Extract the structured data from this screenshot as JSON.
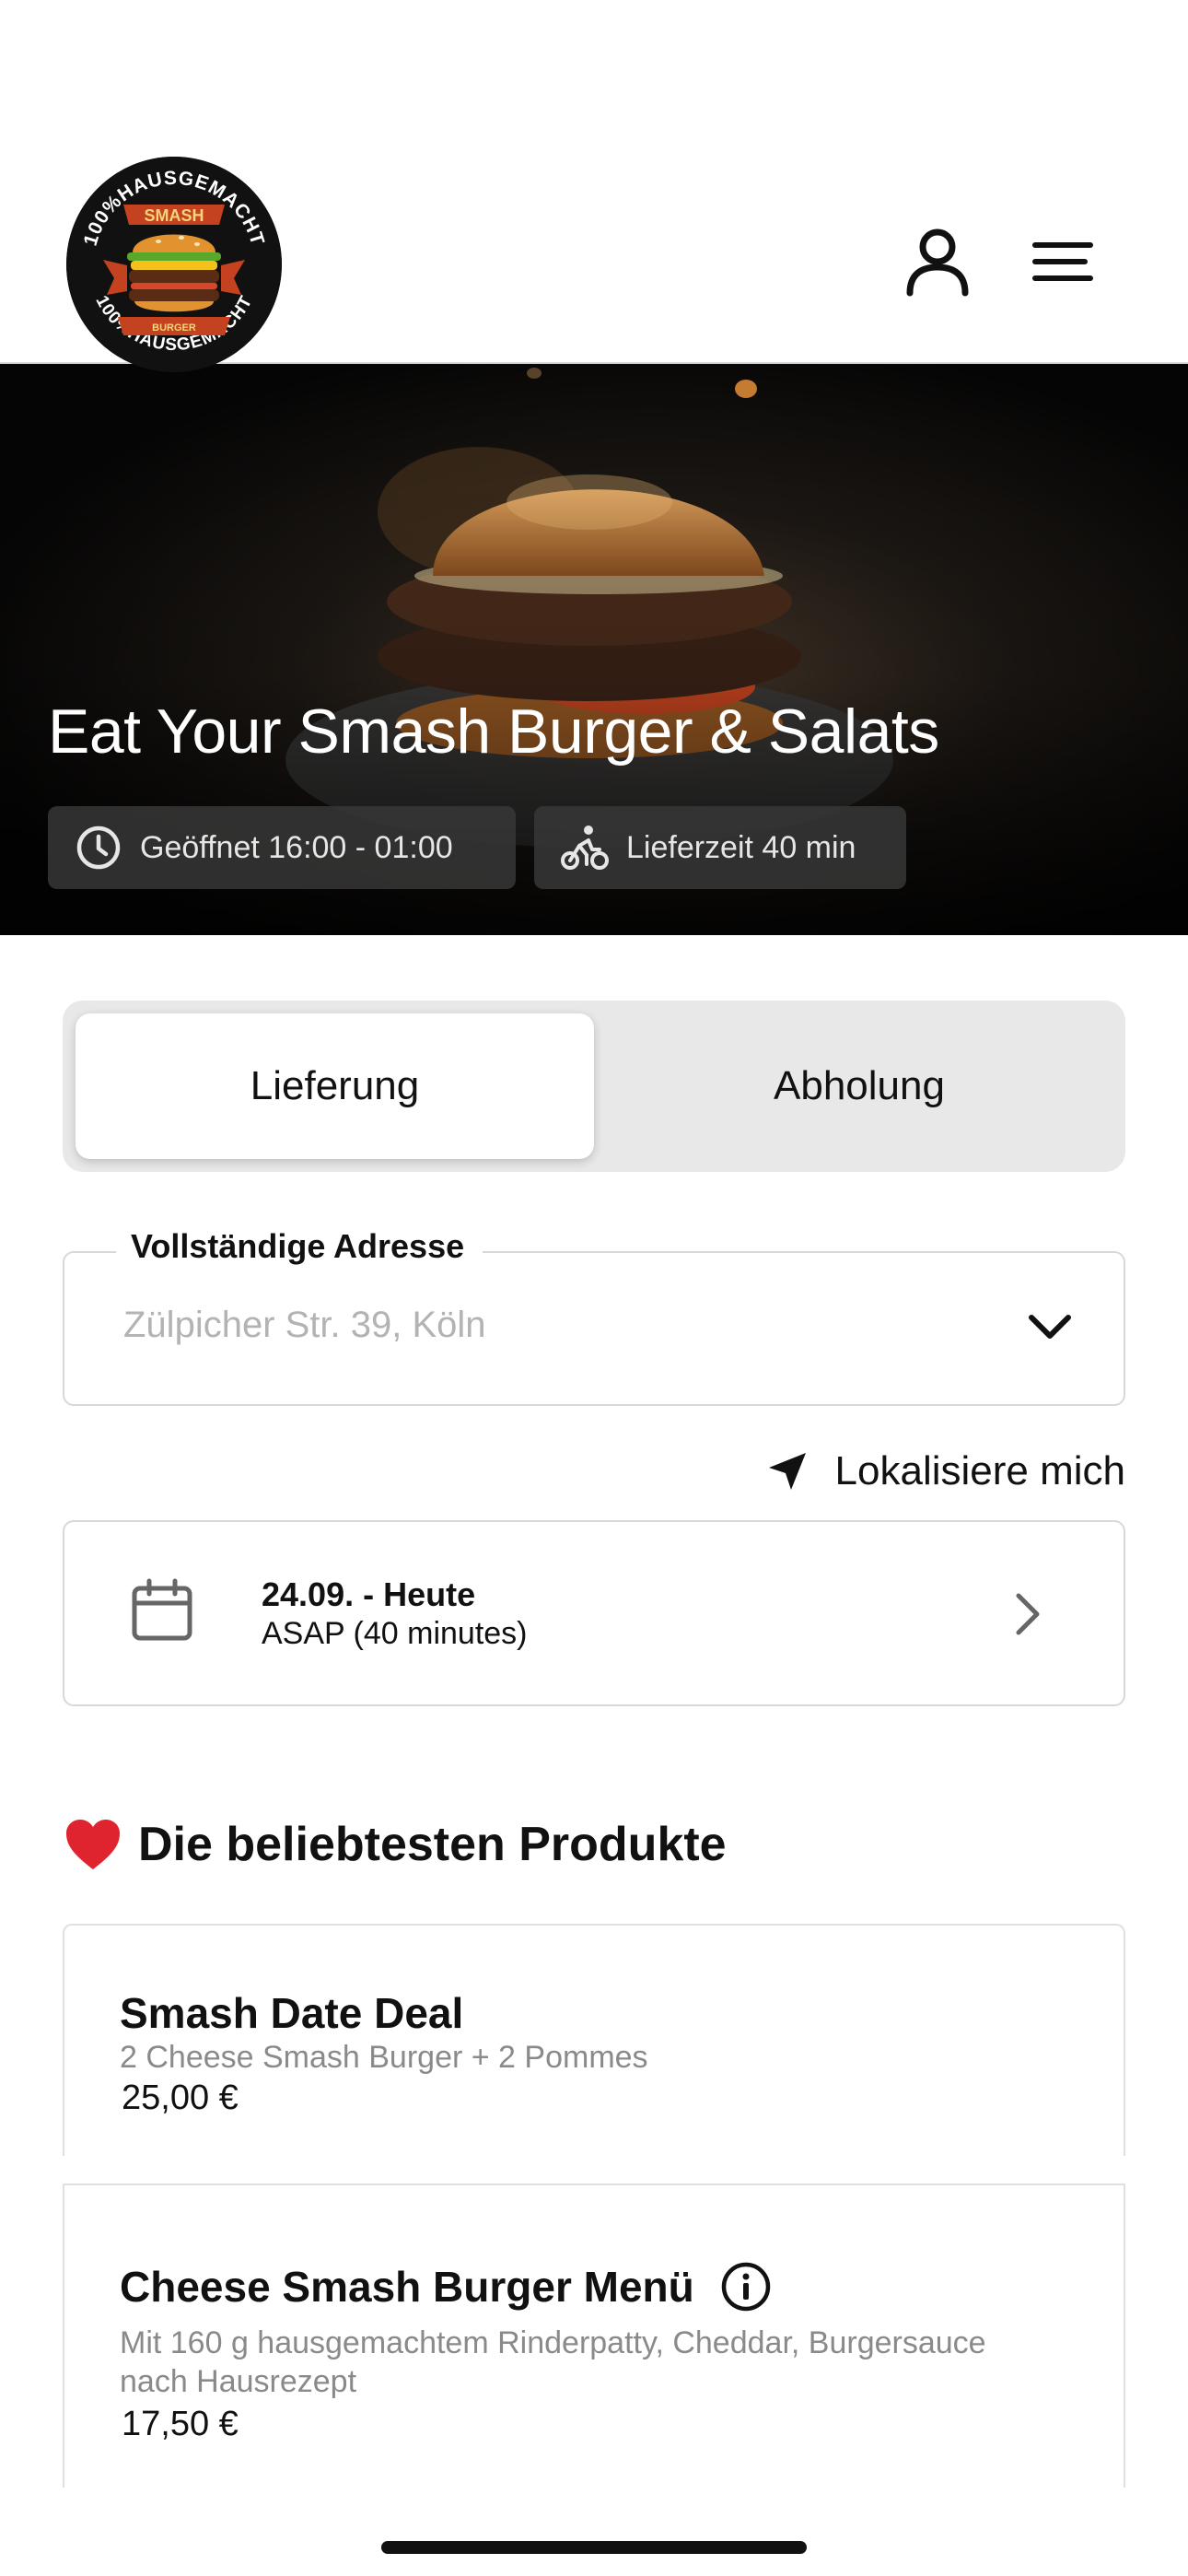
{
  "header": {
    "logo_text_top": "100%HAUSGEMACHT",
    "logo_text_bottom": "100%HAUSGEMACHT",
    "logo_brand": "SMASH",
    "logo_sub": "BURGER",
    "account_icon": "user-icon",
    "menu_icon": "hamburger-menu-icon"
  },
  "hero": {
    "title": "Eat Your Smash Burger & Salats",
    "open_hours": "Geöffnet 16:00 - 01:00",
    "delivery_time": "Lieferzeit 40 min",
    "open_icon": "clock-icon",
    "delivery_icon": "bicycle-icon"
  },
  "order_mode": {
    "options": [
      "Lieferung",
      "Abholung"
    ],
    "selected": "Lieferung"
  },
  "address": {
    "label": "Vollständige Adresse",
    "placeholder": "Zülpicher Str. 39, Köln",
    "value": ""
  },
  "locate": {
    "label": "Lokalisiere mich",
    "icon": "location-arrow-icon"
  },
  "schedule": {
    "date": "24.09. - Heute",
    "time": "ASAP (40 minutes)",
    "icon": "calendar-icon"
  },
  "popular": {
    "title": "Die beliebtesten Produkte",
    "icon": "heart-icon",
    "products": [
      {
        "name": "Smash Date Deal",
        "description": "2 Cheese Smash Burger + 2 Pommes",
        "price": "25,00 €"
      },
      {
        "name": "Cheese Smash Burger Menü",
        "description_line1": "Mit 160 g hausgemachtem Rinderpatty, Cheddar, Burgersauce",
        "description_line2": "nach Hausrezept",
        "price": "17,50 €"
      }
    ]
  },
  "colors": {
    "accent_heart": "#e0242f",
    "hero_bg": "#0c0c0c",
    "segment_bg": "#e8e8e8",
    "border": "#d8d8d8",
    "muted_text": "#8a8a8a"
  }
}
